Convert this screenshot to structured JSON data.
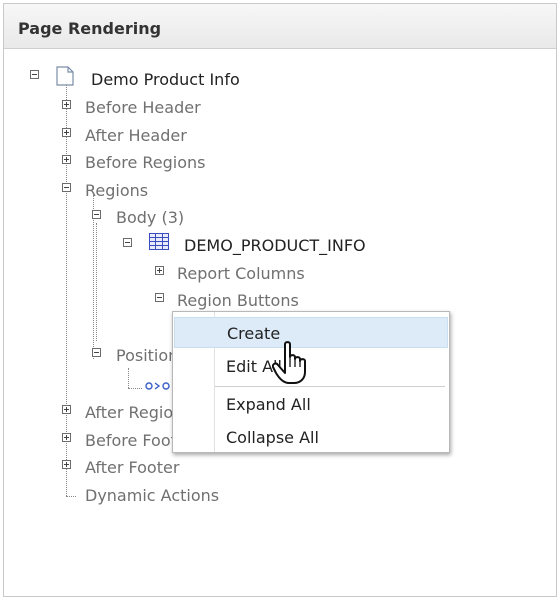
{
  "panel": {
    "title": "Page Rendering"
  },
  "tree": {
    "root": "Demo Product Info",
    "before_header": "Before Header",
    "after_header": "After Header",
    "before_regions": "Before Regions",
    "regions": "Regions",
    "body": "Body (3)",
    "demo_product_info": "DEMO_PRODUCT_INFO",
    "report_columns": "Report Columns",
    "region_buttons": "Region Buttons",
    "position": "Position",
    "after_regions": "After Regions",
    "before_footer": "Before Footer",
    "after_footer": "After Footer",
    "dynamic_actions": "Dynamic Actions"
  },
  "context_menu": {
    "create": "Create",
    "edit_all": "Edit All",
    "expand_all": "Expand All",
    "collapse_all": "Collapse All"
  }
}
